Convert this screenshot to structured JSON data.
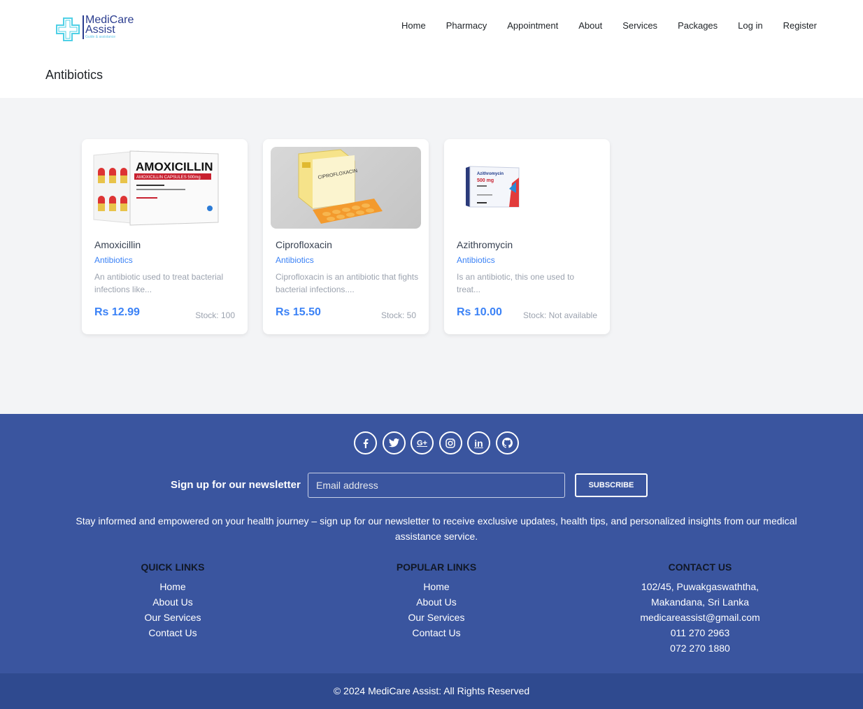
{
  "brand": {
    "name_line1": "MediCare",
    "name_line2": "Assist",
    "tagline": "Guide & assistance",
    "accent": "#2b3d8f",
    "cross_color": "#4fd0e6"
  },
  "nav": [
    "Home",
    "Pharmacy",
    "Appointment",
    "About",
    "Services",
    "Packages",
    "Log in",
    "Register"
  ],
  "page_title": "Antibiotics",
  "products": [
    {
      "name": "Amoxicillin",
      "category": "Antibiotics",
      "description": "An antibiotic used to treat bacterial infections like...",
      "price": "Rs 12.99",
      "stock": "Stock: 100",
      "image_icon": "amoxicillin-package-image",
      "box_label": "AMOXICILLIN",
      "box_sub": "AMOXICILLIN CAPSULES 500mg"
    },
    {
      "name": "Ciprofloxacin",
      "category": "Antibiotics",
      "description": "Ciprofloxacin is an antibiotic that fights bacterial infections....",
      "price": "Rs 15.50",
      "stock": "Stock: 50",
      "image_icon": "ciprofloxacin-package-image",
      "box_label": "CIPROFLOXACIN"
    },
    {
      "name": "Azithromycin",
      "category": "Antibiotics",
      "description": "Is an antibiotic, this one used to treat...",
      "price": "Rs 10.00",
      "stock": "Stock: Not available",
      "image_icon": "azithromycin-package-image",
      "box_label": "Azithromycin",
      "box_sub": "500 mg"
    }
  ],
  "footer": {
    "social": [
      "facebook-icon",
      "twitter-icon",
      "google-plus-icon",
      "instagram-icon",
      "linkedin-icon",
      "github-icon"
    ],
    "newsletter_label": "Sign up for our newsletter",
    "email_placeholder": "Email address",
    "subscribe": "SUBSCRIBE",
    "newsletter_text": "Stay informed and empowered on your health journey – sign up for our newsletter to receive exclusive updates, health tips, and personalized insights from our medical assistance service.",
    "quick_links": {
      "title": "QUICK LINKS",
      "items": [
        "Home",
        "About Us",
        "Our Services",
        "Contact Us"
      ]
    },
    "popular_links": {
      "title": "POPULAR LINKS",
      "items": [
        "Home",
        "About Us",
        "Our Services",
        "Contact Us"
      ]
    },
    "contact": {
      "title": "CONTACT US",
      "items": [
        "102/45, Puwakgaswaththa,",
        "Makandana, Sri Lanka",
        "medicareassist@gmail.com",
        "011 270 2963",
        "072 270 1880"
      ]
    },
    "copyright": "© 2024 MediCare Assist: All Rights Reserved",
    "bg": "#3a559f"
  }
}
